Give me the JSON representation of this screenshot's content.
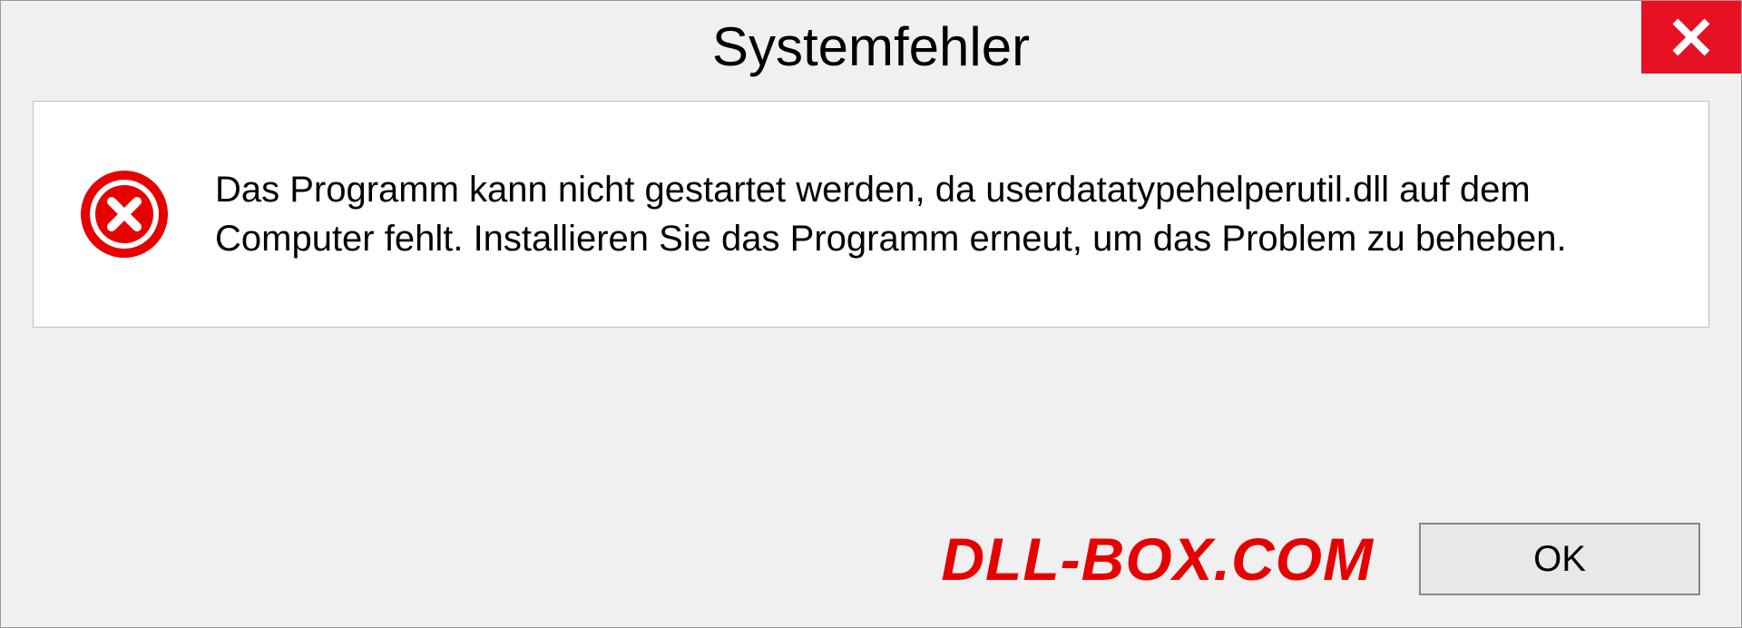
{
  "dialog": {
    "title": "Systemfehler",
    "message": "Das Programm kann nicht gestartet werden, da userdatatypehelperutil.dll auf dem Computer fehlt. Installieren Sie das Programm erneut, um das Problem zu beheben.",
    "ok_label": "OK"
  },
  "watermark": "DLL-BOX.COM",
  "colors": {
    "close_bg": "#e81123",
    "error_icon": "#e60000",
    "watermark": "#e60000"
  }
}
